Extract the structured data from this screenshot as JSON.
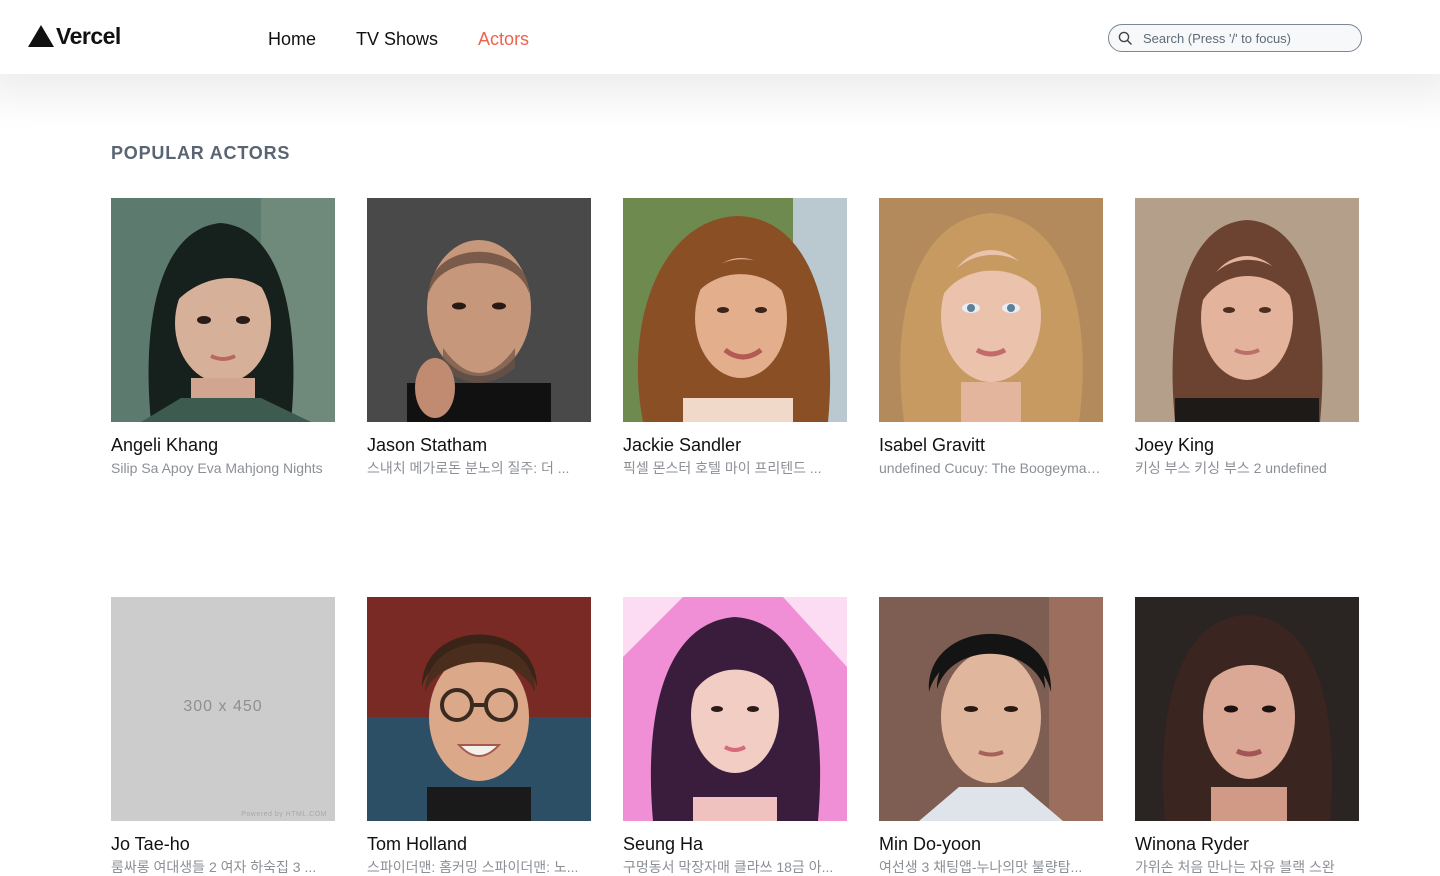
{
  "brand": {
    "name": "Vercel"
  },
  "nav": {
    "items": [
      {
        "label": "Home",
        "active": false
      },
      {
        "label": "TV Shows",
        "active": false
      },
      {
        "label": "Actors",
        "active": true
      }
    ]
  },
  "search": {
    "placeholder": "Search (Press '/' to focus)",
    "value": ""
  },
  "section": {
    "title": "POPULAR ACTORS"
  },
  "actors": [
    {
      "name": "Angeli Khang",
      "known_for": "Silip Sa Apoy Eva Mahjong Nights"
    },
    {
      "name": "Jason Statham",
      "known_for": "스내치 메가로돈 분노의 질주: 더 ..."
    },
    {
      "name": "Jackie Sandler",
      "known_for": "픽셀 몬스터 호텔 마이 프리텐드 ..."
    },
    {
      "name": "Isabel Gravitt",
      "known_for": "undefined Cucuy: The Boogeyman..."
    },
    {
      "name": "Joey King",
      "known_for": "키싱 부스 키싱 부스 2 undefined"
    },
    {
      "name": "Jo Tae-ho",
      "known_for": "룸싸롱 여대생들 2 여자 하숙집 3 ...",
      "placeholder_text": "300 x 450",
      "placeholder_credit": "Powered by HTML.COM"
    },
    {
      "name": "Tom Holland",
      "known_for": "스파이더맨: 홈커밍 스파이더맨: 노..."
    },
    {
      "name": "Seung Ha",
      "known_for": "구멍동서 막장자매 클라쓰 18금 아..."
    },
    {
      "name": "Min Do-yoon",
      "known_for": "여선생 3 채팅앱-누나의맛 불량탐..."
    },
    {
      "name": "Winona Ryder",
      "known_for": "가위손 처음 만나는 자유 블랙 스완"
    }
  ],
  "colors": {
    "accent": "#f0624d",
    "muted_text": "#8b8f96",
    "section_title": "#5a6472"
  }
}
